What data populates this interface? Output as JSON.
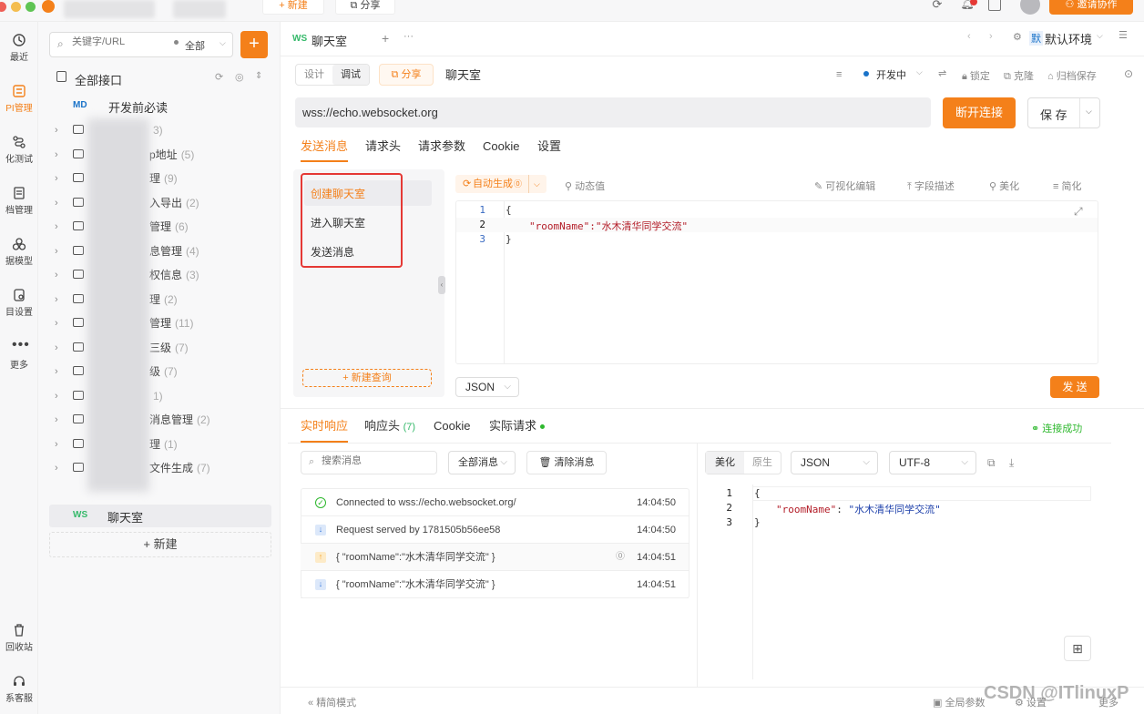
{
  "topbar": {
    "new_label": "新建",
    "share_label": "分享",
    "invite_label": "邀请协作"
  },
  "left_nav": [
    {
      "label": "最近",
      "icon": "clock-icon"
    },
    {
      "label": "PI管理",
      "icon": "api-icon",
      "active": true
    },
    {
      "label": "化测试",
      "icon": "flow-icon"
    },
    {
      "label": "档管理",
      "icon": "doc-icon"
    },
    {
      "label": "据模型",
      "icon": "model-icon"
    },
    {
      "label": "目设置",
      "icon": "settings-icon"
    },
    {
      "label": "更多",
      "icon": "more-icon"
    },
    {
      "label": "回收站",
      "icon": "trash-icon"
    },
    {
      "label": "系客服",
      "icon": "headset-icon"
    }
  ],
  "tree": {
    "search_placeholder": "关键字/URL",
    "filter_label": "全部",
    "root_label": "全部接口",
    "md_badge": "MD",
    "md_item": "开发前必读",
    "folders": [
      {
        "label": "",
        "count": "3)"
      },
      {
        "label": "p地址",
        "count": "(5)"
      },
      {
        "label": "理",
        "count": "(9)"
      },
      {
        "label": "入导出",
        "count": "(2)"
      },
      {
        "label": "管理",
        "count": "(6)"
      },
      {
        "label": "息管理",
        "count": "(4)"
      },
      {
        "label": "权信息",
        "count": "(3)"
      },
      {
        "label": "理",
        "count": "(2)"
      },
      {
        "label": "管理",
        "count": "(11)"
      },
      {
        "label": "三级",
        "count": "(7)"
      },
      {
        "label": "级",
        "count": "(7)"
      },
      {
        "label": "",
        "count": "1)"
      },
      {
        "label": "消息管理",
        "count": "(2)"
      },
      {
        "label": "理",
        "count": "(1)"
      },
      {
        "label": "文件生成",
        "count": "(7)"
      }
    ],
    "ws_badge": "WS",
    "ws_item": "聊天室",
    "new_label": "新建"
  },
  "doc_tab": {
    "badge": "WS",
    "title": "聊天室",
    "env_prefix": "默",
    "env_label": "默认环境"
  },
  "toolbar": {
    "design": "设计",
    "debug": "调试",
    "share": "分享",
    "name": "聊天室",
    "status": "开发中",
    "lock": "锁定",
    "clone": "克隆",
    "archive": "归档保存"
  },
  "url": {
    "value": "wss://echo.websocket.org",
    "disconnect": "断开连接",
    "save": "保 存"
  },
  "req_tabs": [
    "发送消息",
    "请求头",
    "请求参数",
    "Cookie",
    "设置"
  ],
  "messages_list": [
    "创建聊天室",
    "进入聊天室",
    "发送消息"
  ],
  "new_query": "新建查询",
  "editor_tools": {
    "auto_gen": "自动生成",
    "dynamic": "动态值",
    "visual_edit": "可视化编辑",
    "field_desc": "字段描述",
    "beautify": "美化",
    "simplify": "简化"
  },
  "editor_lines": [
    "{",
    "\"roomName\":\"水木清华同学交流\"",
    "}"
  ],
  "format": "JSON",
  "send": "发 送",
  "resp_tabs": {
    "realtime": "实时响应",
    "headers": "响应头",
    "headers_count": "(7)",
    "cookie": "Cookie",
    "actual": "实际请求",
    "connected": "连接成功"
  },
  "msg_filters": {
    "search_placeholder": "搜索消息",
    "all": "全部消息",
    "clear": "清除消息"
  },
  "log": [
    {
      "text": "Connected to wss://echo.websocket.org/",
      "time": "14:04:50",
      "kind": "ok"
    },
    {
      "text": "Request served by 1781505b56ee58",
      "time": "14:04:50",
      "kind": "down"
    },
    {
      "text": "{ \"roomName\":\"水木清华同学交流\" }",
      "time": "14:04:51",
      "kind": "up"
    },
    {
      "text": "{ \"roomName\":\"水木清华同学交流\" }",
      "time": "14:04:51",
      "kind": "down"
    }
  ],
  "viewer": {
    "pretty": "美化",
    "raw": "原生",
    "format": "JSON",
    "encoding": "UTF-8"
  },
  "footer": {
    "simple_mode": "精简模式",
    "global_params": "全局参数",
    "settings": "设置",
    "more": "更多",
    "watermark": "CSDN @ITlinuxP"
  },
  "colors": {
    "accent": "#f4801a",
    "highlight": "#e53935",
    "success": "#2eb82e"
  }
}
